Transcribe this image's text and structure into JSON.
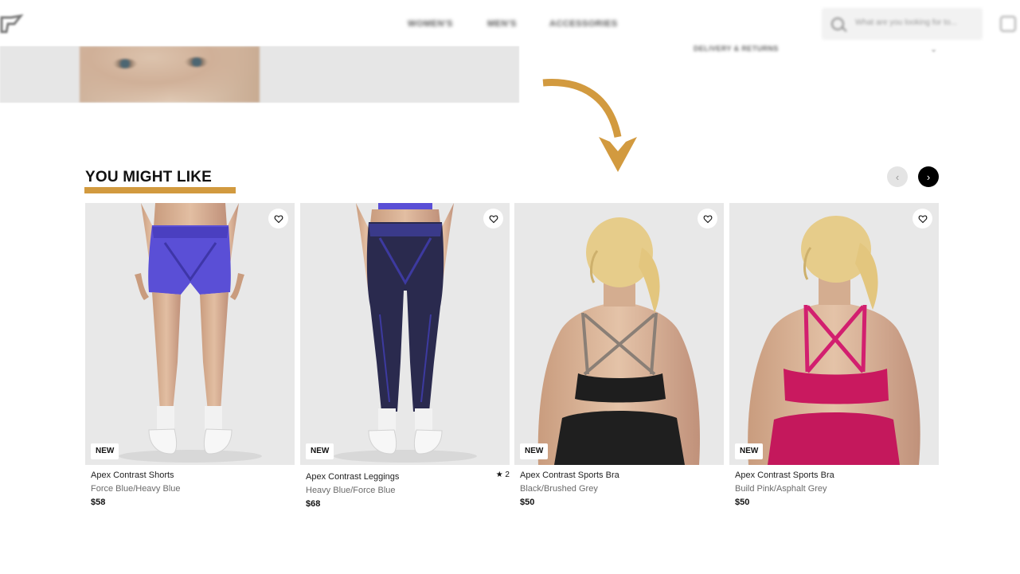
{
  "header": {
    "nav": [
      "WOMEN'S",
      "MEN'S",
      "ACCESSORIES"
    ],
    "search_placeholder": "What are you looking for to..."
  },
  "hero": {
    "side_text": "DELIVERY & RETURNS"
  },
  "section": {
    "title": "YOU MIGHT LIKE"
  },
  "colors": {
    "accent": "#d29a3f",
    "next_button": "#000000",
    "card_background": "#e8e8e8"
  },
  "products": [
    {
      "badge": "NEW",
      "name": "Apex Contrast Shorts",
      "color": "Force Blue/Heavy Blue",
      "price": "$58",
      "rating": ""
    },
    {
      "badge": "NEW",
      "name": "Apex Contrast Leggings",
      "color": "Heavy Blue/Force Blue",
      "price": "$68",
      "rating": "★ 2"
    },
    {
      "badge": "NEW",
      "name": "Apex Contrast Sports Bra",
      "color": "Black/Brushed Grey",
      "price": "$50",
      "rating": ""
    },
    {
      "badge": "NEW",
      "name": "Apex Contrast Sports Bra",
      "color": "Build Pink/Asphalt Grey",
      "price": "$50",
      "rating": ""
    }
  ],
  "icons": {
    "prev": "chevron-left-icon",
    "next": "chevron-right-icon",
    "wishlist": "heart-icon",
    "search": "search-icon"
  }
}
